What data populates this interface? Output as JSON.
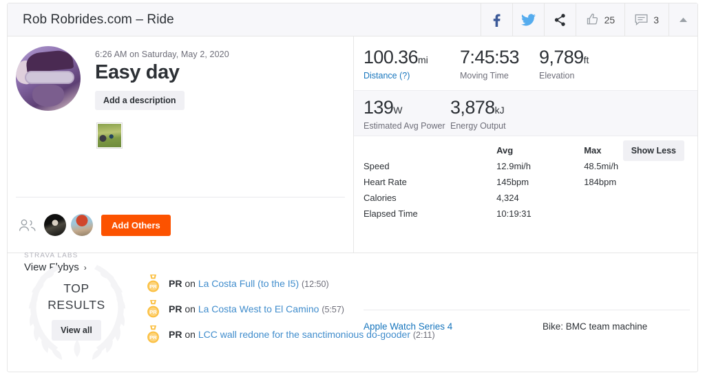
{
  "header": {
    "title": "Rob Robrides.com – Ride",
    "actions": [
      {
        "name": "facebook-share-button",
        "icon": "facebook-icon",
        "label": ""
      },
      {
        "name": "twitter-share-button",
        "icon": "twitter-icon",
        "label": ""
      },
      {
        "name": "share-button",
        "icon": "share-icon",
        "label": ""
      },
      {
        "name": "kudos-button",
        "icon": "thumbs-up-icon",
        "label": "25"
      },
      {
        "name": "comments-button",
        "icon": "comment-icon",
        "label": "3"
      },
      {
        "name": "collapse-button",
        "icon": "chevron-up-icon",
        "label": ""
      }
    ],
    "kudos_count": "25",
    "comments_count": "3"
  },
  "activity": {
    "date": "6:26 AM on Saturday, May 2, 2020",
    "title": "Easy day",
    "add_description_label": "Add a description",
    "athlete_avatar": "athlete-avatar",
    "photo_thumb": "activity-photo-thumbnail"
  },
  "others": {
    "add_others_label": "Add Others",
    "people_icon": "people-icon"
  },
  "labs": {
    "kicker": "STRAVA LABS",
    "link": "View Flybys",
    "chevron": "›"
  },
  "stats": {
    "primary": [
      {
        "value": "100.36",
        "unit": "mi",
        "label": "Distance (?)",
        "is_link": true
      },
      {
        "value": "7:45:53",
        "unit": "",
        "label": "Moving Time",
        "is_link": false
      },
      {
        "value": "9,789",
        "unit": "ft",
        "label": "Elevation",
        "is_link": false
      }
    ],
    "power": [
      {
        "value": "139",
        "unit": "W",
        "label": "Estimated Avg Power"
      },
      {
        "value": "3,878",
        "unit": "kJ",
        "label": "Energy Output"
      }
    ],
    "table": {
      "headers": [
        "",
        "Avg",
        "Max"
      ],
      "rows": [
        [
          "Speed",
          "12.9mi/h",
          "48.5mi/h"
        ],
        [
          "Heart Rate",
          "145bpm",
          "184bpm"
        ],
        [
          "Calories",
          "4,324",
          ""
        ],
        [
          "Elapsed Time",
          "10:19:31",
          ""
        ]
      ]
    },
    "show_less_label": "Show Less"
  },
  "gear": {
    "device": "Apple Watch Series 4",
    "bike": "Bike: BMC team machine"
  },
  "results": {
    "heading_line1": "TOP",
    "heading_line2": "RESULTS",
    "view_all_label": "View all",
    "wreath_icon": "laurel-wreath-icon",
    "items": [
      {
        "badge": "PR",
        "prefix": "on",
        "segment": "La Costa Full (to the I5)",
        "time": "(12:50)"
      },
      {
        "badge": "PR",
        "prefix": "on",
        "segment": "La Costa West to El Camino",
        "time": "(5:57)"
      },
      {
        "badge": "PR",
        "prefix": "on",
        "segment": "LCC wall redone for the sanctimonious do-gooder",
        "time": "(2:11)"
      }
    ]
  },
  "colors": {
    "brand_orange": "#fc5200",
    "link_blue": "#1675bd",
    "segment_blue": "#3f8ccc",
    "facebook": "#3b5998",
    "twitter": "#55acee",
    "medal_gold": "#fbbf3f"
  }
}
